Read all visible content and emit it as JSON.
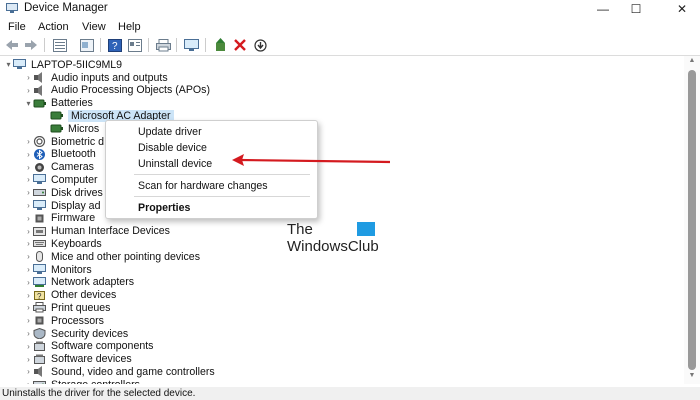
{
  "window": {
    "title": "Device Manager"
  },
  "menubar": [
    "File",
    "Action",
    "View",
    "Help"
  ],
  "tree": {
    "root": "LAPTOP-5IIC9ML9",
    "items": [
      {
        "label": "Audio inputs and outputs",
        "icon": "speaker-icon",
        "expanded": false
      },
      {
        "label": "Audio Processing Objects (APOs)",
        "icon": "speaker-icon",
        "expanded": false
      },
      {
        "label": "Batteries",
        "icon": "battery-icon",
        "expanded": true
      },
      {
        "label": "Microsoft AC Adapter",
        "icon": "battery-icon",
        "child": true,
        "selected": true
      },
      {
        "label": "Micros",
        "icon": "battery-icon",
        "child": true
      },
      {
        "label": "Biometric d",
        "icon": "fingerprint-icon",
        "expanded": false
      },
      {
        "label": "Bluetooth",
        "icon": "bluetooth-icon",
        "expanded": false
      },
      {
        "label": "Cameras",
        "icon": "camera-icon",
        "expanded": false
      },
      {
        "label": "Computer",
        "icon": "monitor-icon",
        "expanded": false
      },
      {
        "label": "Disk drives",
        "icon": "disk-icon",
        "expanded": false
      },
      {
        "label": "Display ad",
        "icon": "monitor-icon",
        "expanded": false
      },
      {
        "label": "Firmware",
        "icon": "chip-icon",
        "expanded": false
      },
      {
        "label": "Human Interface Devices",
        "icon": "hid-icon",
        "expanded": false
      },
      {
        "label": "Keyboards",
        "icon": "keyboard-icon",
        "expanded": false
      },
      {
        "label": "Mice and other pointing devices",
        "icon": "mouse-icon",
        "expanded": false
      },
      {
        "label": "Monitors",
        "icon": "monitor-icon",
        "expanded": false
      },
      {
        "label": "Network adapters",
        "icon": "network-icon",
        "expanded": false
      },
      {
        "label": "Other devices",
        "icon": "unknown-device-icon",
        "expanded": false
      },
      {
        "label": "Print queues",
        "icon": "printer-icon",
        "expanded": false
      },
      {
        "label": "Processors",
        "icon": "chip-icon",
        "expanded": false
      },
      {
        "label": "Security devices",
        "icon": "security-icon",
        "expanded": false
      },
      {
        "label": "Software components",
        "icon": "component-icon",
        "expanded": false
      },
      {
        "label": "Software devices",
        "icon": "component-icon",
        "expanded": false
      },
      {
        "label": "Sound, video and game controllers",
        "icon": "speaker-icon",
        "expanded": false
      },
      {
        "label": "Storage controllers",
        "icon": "disk-icon",
        "expanded": false
      }
    ]
  },
  "context_menu": {
    "update": "Update driver",
    "disable": "Disable device",
    "uninstall": "Uninstall device",
    "scan": "Scan for hardware changes",
    "properties": "Properties"
  },
  "status": "Uninstalls the driver for the selected device.",
  "watermark": {
    "line1": "The",
    "line2": "WindowsClub"
  },
  "colors": {
    "arrow": "#d41a1f",
    "selection": "#cce4f7",
    "accent": "#1f9be2"
  }
}
